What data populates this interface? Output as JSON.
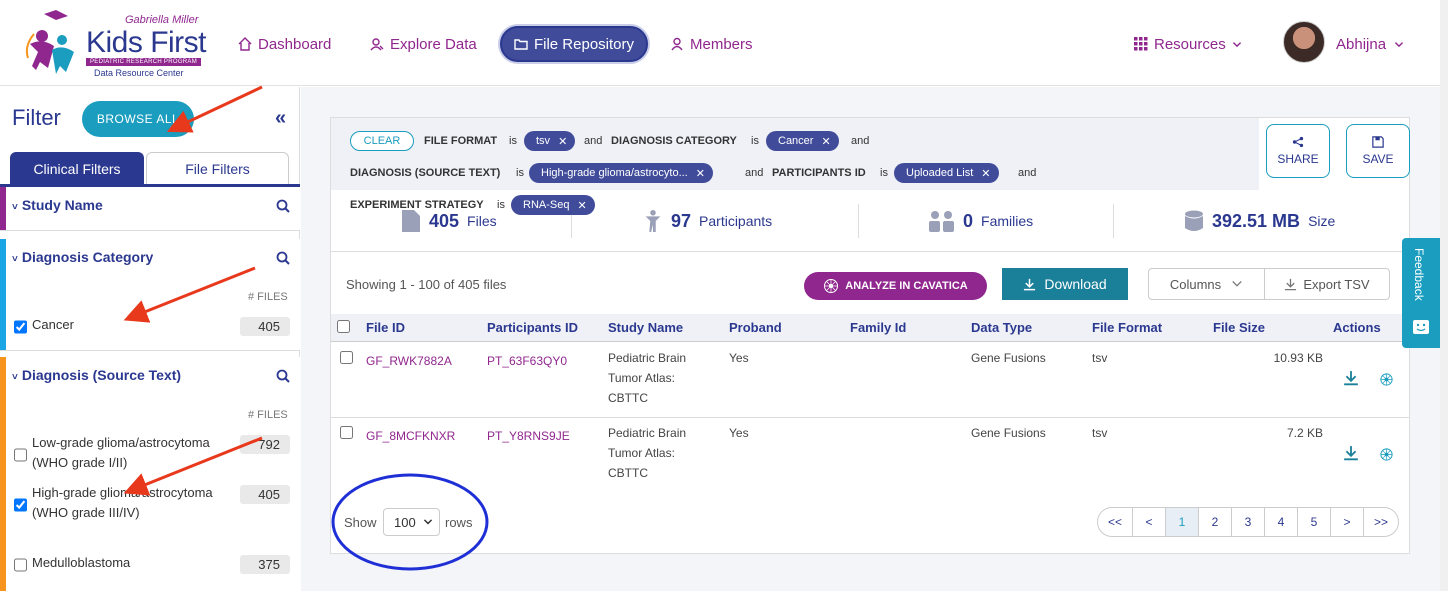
{
  "brand": {
    "org": "Gabriella Miller",
    "name": "Kids First",
    "program": "PEDIATRIC RESEARCH PROGRAM",
    "sub": "Data Resource Center"
  },
  "nav": {
    "dashboard": "Dashboard",
    "explore": "Explore Data",
    "repository": "File Repository",
    "members": "Members",
    "resources": "Resources",
    "user": "Abhijna"
  },
  "sidebar": {
    "title": "Filter",
    "browse_all": "BROWSE ALL",
    "tabs": {
      "clinical": "Clinical Filters",
      "file": "File Filters"
    },
    "files_header": "# FILES",
    "sections": {
      "study": {
        "title": "Study Name"
      },
      "diag_cat": {
        "title": "Diagnosis Category",
        "options": [
          {
            "label": "Cancer",
            "count": "405",
            "checked": true
          }
        ]
      },
      "diag_src": {
        "title": "Diagnosis (Source Text)",
        "options": [
          {
            "label": "Low-grade glioma/astrocytoma (WHO grade I/II)",
            "count": "792",
            "checked": false
          },
          {
            "label": "High-grade glioma/astrocytoma (WHO grade III/IV)",
            "count": "405",
            "checked": true
          },
          {
            "label": "Medulloblastoma",
            "count": "375",
            "checked": false
          }
        ]
      }
    }
  },
  "query": {
    "clear": "CLEAR",
    "is": "is",
    "and": "and",
    "fields": {
      "file_format": "FILE FORMAT",
      "diag_cat": "DIAGNOSIS CATEGORY",
      "diag_src": "DIAGNOSIS (SOURCE TEXT)",
      "participants": "PARTICIPANTS ID",
      "strategy": "EXPERIMENT STRATEGY"
    },
    "values": {
      "file_format": "tsv",
      "diag_cat": "Cancer",
      "diag_src": "High-grade glioma/astrocyto...",
      "participants": "Uploaded List",
      "strategy": "RNA-Seq"
    },
    "share": "SHARE",
    "save": "SAVE"
  },
  "stats": {
    "files": {
      "n": "405",
      "label": "Files"
    },
    "participants": {
      "n": "97",
      "label": "Participants"
    },
    "families": {
      "n": "0",
      "label": "Families"
    },
    "size": {
      "n": "392.51 MB",
      "label": "Size"
    }
  },
  "table": {
    "showing": "Showing 1 - 100 of 405 files",
    "analyze": "ANALYZE IN CAVATICA",
    "download": "Download",
    "columns": "Columns",
    "export": "Export TSV",
    "headers": [
      "File ID",
      "Participants ID",
      "Study Name",
      "Proband",
      "Family Id",
      "Data Type",
      "File Format",
      "File Size",
      "Actions"
    ],
    "rows": [
      {
        "file_id": "GF_RWK7882A",
        "participant": "PT_63F63QY0",
        "study": [
          "Pediatric Brain",
          "Tumor Atlas:",
          "CBTTC"
        ],
        "proband": "Yes",
        "family": "",
        "data_type": "Gene Fusions",
        "format": "tsv",
        "size": "10.93 KB"
      },
      {
        "file_id": "GF_8MCFKNXR",
        "participant": "PT_Y8RNS9JE",
        "study": [
          "Pediatric Brain",
          "Tumor Atlas:",
          "CBTTC"
        ],
        "proband": "Yes",
        "family": "",
        "data_type": "Gene Fusions",
        "format": "tsv",
        "size": "7.2 KB"
      }
    ]
  },
  "pagination": {
    "show": "Show",
    "rows_value": "100",
    "rows": "rows",
    "pages": [
      "<<",
      "<",
      "1",
      "2",
      "3",
      "4",
      "5",
      ">",
      ">>"
    ],
    "current": "1"
  },
  "feedback": "Feedback",
  "colors": {
    "purple": "#90278e",
    "navy": "#2b388f",
    "teal": "#1a9dbf",
    "annotation_red": "#e8391d",
    "annotation_blue": "#1f2fd6"
  }
}
